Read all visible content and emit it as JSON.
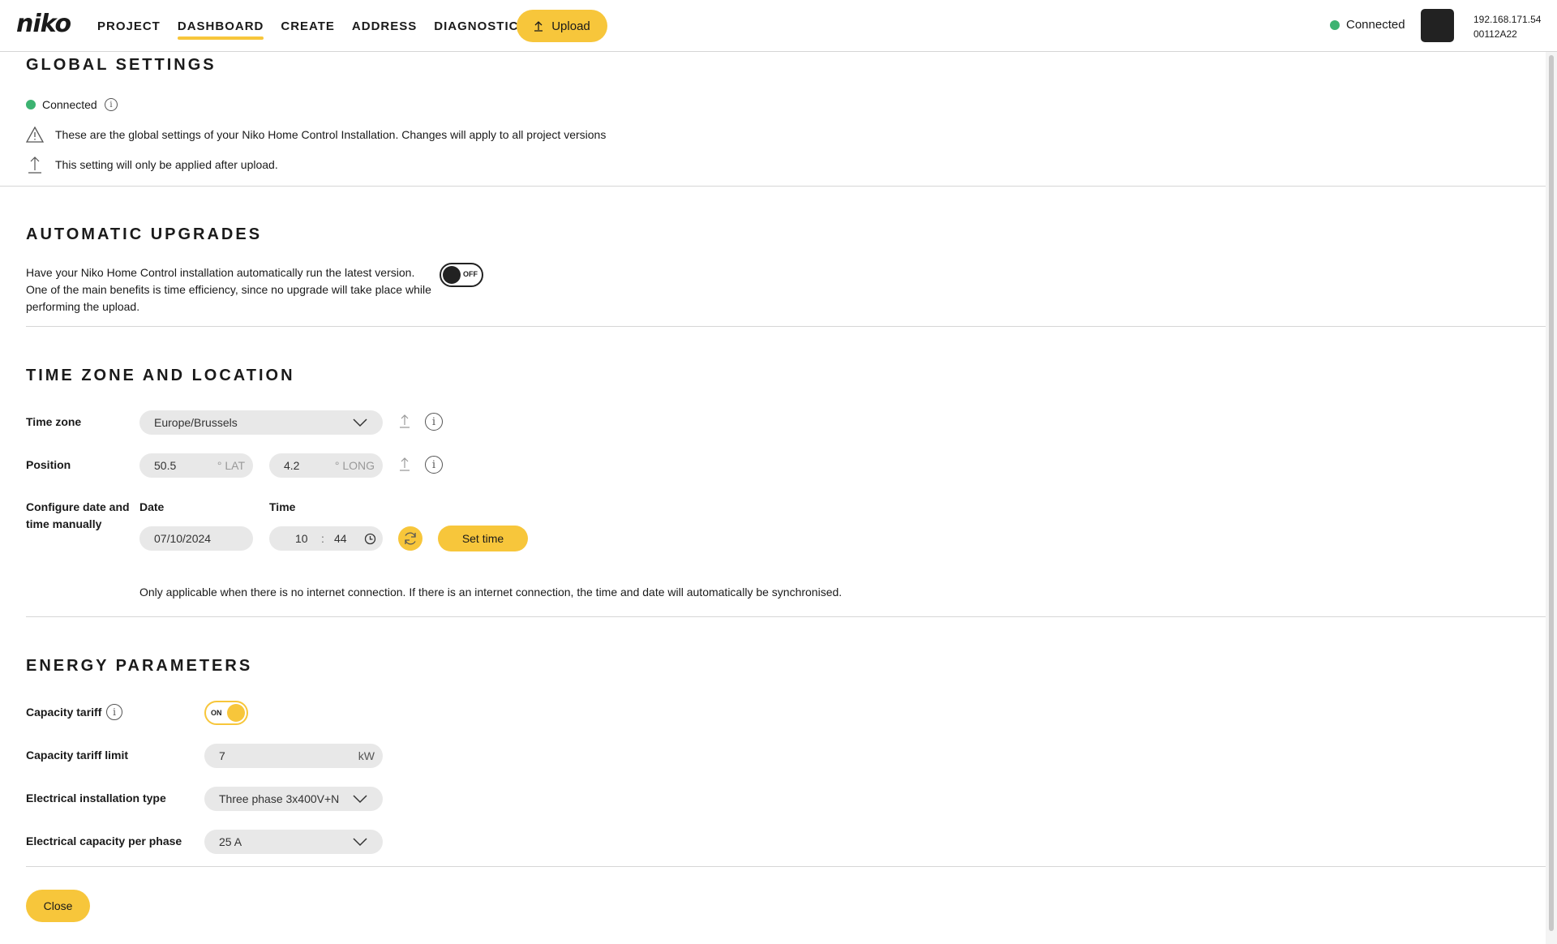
{
  "header": {
    "logo": "niko",
    "nav": [
      "PROJECT",
      "DASHBOARD",
      "CREATE",
      "ADDRESS",
      "DIAGNOSTICS"
    ],
    "active_nav": "DASHBOARD",
    "upload_label": "Upload",
    "status": "Connected",
    "ip": "192.168.171.54",
    "serial": "00112A22"
  },
  "global": {
    "title": "GLOBAL SETTINGS",
    "status": "Connected",
    "warning": "These are the global settings of your Niko Home Control Installation. Changes will apply to all project versions",
    "upload_note": "This setting will only be applied after upload."
  },
  "upgrades": {
    "title": "AUTOMATIC UPGRADES",
    "line1": "Have your Niko Home Control installation automatically run the latest version.",
    "line2": "One of the main benefits is time efficiency, since no upgrade will take place while",
    "line3": "performing the upload.",
    "toggle_label": "OFF",
    "enabled": false
  },
  "timezone": {
    "title": "TIME ZONE AND LOCATION",
    "tz_label": "Time zone",
    "tz_value": "Europe/Brussels",
    "position_label": "Position",
    "lat": "50.5",
    "lat_unit": "° LAT",
    "long": "4.2",
    "long_unit": "° LONG",
    "manual_label_1": "Configure date and",
    "manual_label_2": "time manually",
    "date_label": "Date",
    "date_value": "07/10/2024",
    "time_label": "Time",
    "hour": "10",
    "sep": ":",
    "minute": "44",
    "set_time": "Set time",
    "note": "Only applicable when there is no internet connection. If there is an internet connection, the time and date will automatically be synchronised."
  },
  "energy": {
    "title": "ENERGY PARAMETERS",
    "capacity_tariff_label": "Capacity tariff",
    "capacity_tariff_toggle": "ON",
    "capacity_tariff_enabled": true,
    "limit_label": "Capacity tariff limit",
    "limit_value": "7",
    "limit_unit": "kW",
    "install_type_label": "Electrical installation type",
    "install_type_value": "Three phase 3x400V+N",
    "capacity_phase_label": "Electrical capacity per phase",
    "capacity_phase_value": "25 A"
  },
  "footer": {
    "close": "Close"
  },
  "colors": {
    "accent": "#f7c63b",
    "connected": "#3cb371",
    "field": "#e8e8e8"
  }
}
